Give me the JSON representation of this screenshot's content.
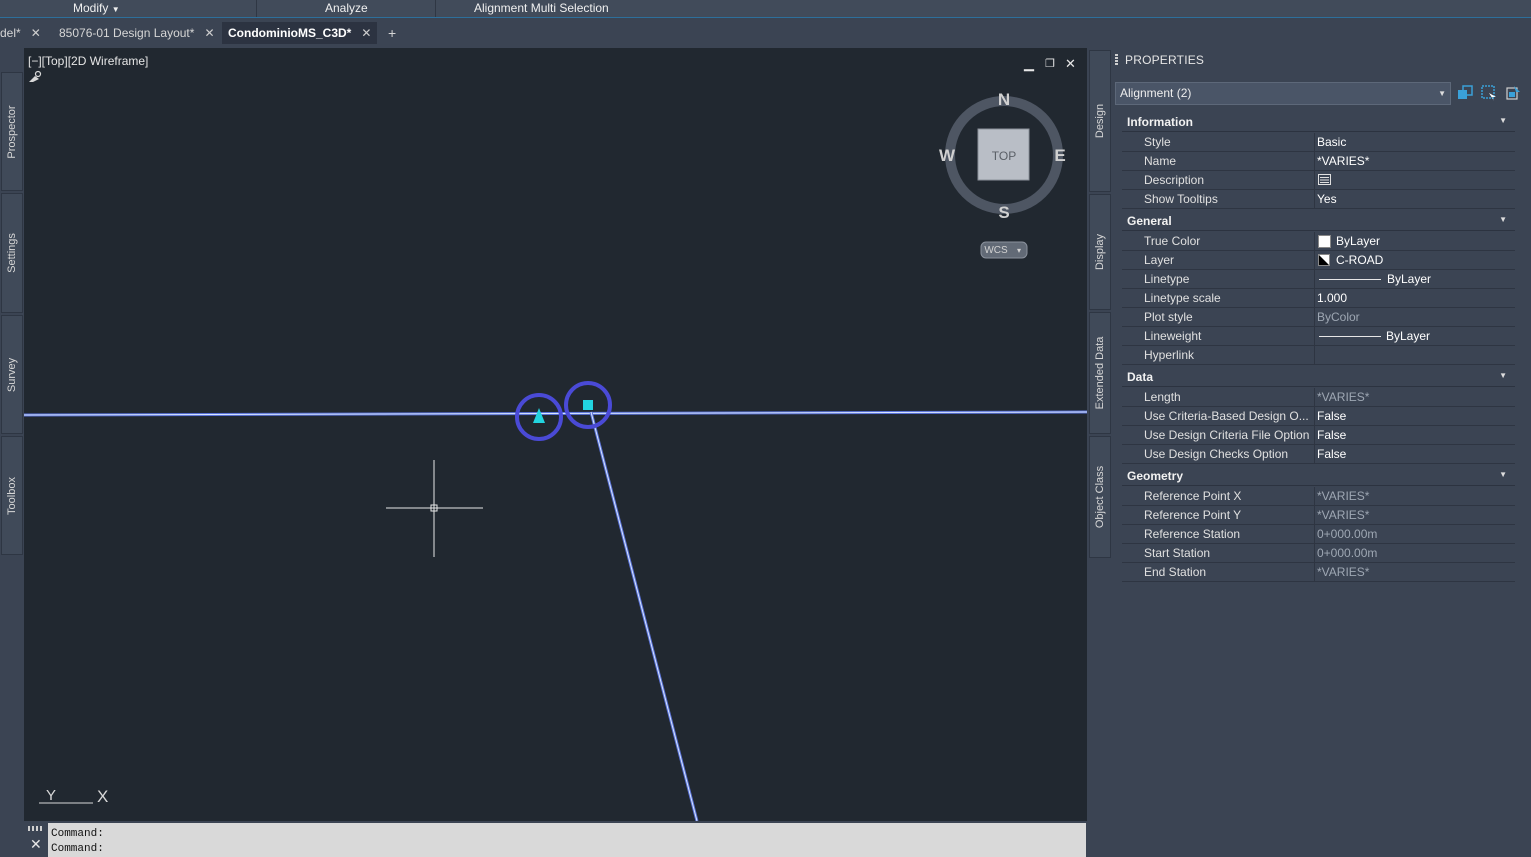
{
  "ribbon": {
    "modify": "Modify",
    "analyze": "Analyze",
    "alignment_multi_selection": "Alignment Multi Selection"
  },
  "tabs": [
    {
      "label": "del*"
    },
    {
      "label": "85076-01 Design Layout*"
    },
    {
      "label": "CondominioMS_C3D*"
    }
  ],
  "tab_close": "✕",
  "tab_add": "+",
  "left_panels": [
    "Prospector",
    "Settings",
    "Survey",
    "Toolbox"
  ],
  "viewport": {
    "label": "[−][Top][2D Wireframe]",
    "viewcube": {
      "n": "N",
      "s": "S",
      "e": "E",
      "w": "W",
      "top": "TOP",
      "wcs": "WCS"
    },
    "ucs": {
      "y": "Y",
      "x": "X"
    }
  },
  "command": {
    "lines": [
      "Command:",
      "Command:"
    ]
  },
  "mid_panels": [
    "Design",
    "Display",
    "Extended Data",
    "Object Class"
  ],
  "properties": {
    "title": "PROPERTIES",
    "selection": "Alignment (2)",
    "categories": [
      {
        "name": "Information",
        "rows": [
          {
            "key": "Style",
            "value": "Basic"
          },
          {
            "key": "Name",
            "value": "*VARIES*"
          },
          {
            "key": "Description",
            "value": ""
          },
          {
            "key": "Show Tooltips",
            "value": "Yes"
          }
        ]
      },
      {
        "name": "General",
        "rows": [
          {
            "key": "True Color",
            "value": "ByLayer"
          },
          {
            "key": "Layer",
            "value": "C-ROAD"
          },
          {
            "key": "Linetype",
            "value": "ByLayer"
          },
          {
            "key": "Linetype scale",
            "value": "1.000"
          },
          {
            "key": "Plot style",
            "value": "ByColor"
          },
          {
            "key": "Lineweight",
            "value": "ByLayer"
          },
          {
            "key": "Hyperlink",
            "value": ""
          }
        ]
      },
      {
        "name": "Data",
        "rows": [
          {
            "key": "Length",
            "value": "*VARIES*"
          },
          {
            "key": "Use  Criteria-Based  Design  O...",
            "value": "False"
          },
          {
            "key": "Use Design Criteria File Option",
            "value": "False"
          },
          {
            "key": "Use Design Checks Option",
            "value": "False"
          }
        ]
      },
      {
        "name": "Geometry",
        "rows": [
          {
            "key": "Reference Point X",
            "value": "*VARIES*"
          },
          {
            "key": "Reference Point Y",
            "value": "*VARIES*"
          },
          {
            "key": "Reference Station",
            "value": "0+000.00m"
          },
          {
            "key": "Start Station",
            "value": "0+000.00m"
          },
          {
            "key": "End Station",
            "value": "*VARIES*"
          }
        ]
      }
    ]
  }
}
